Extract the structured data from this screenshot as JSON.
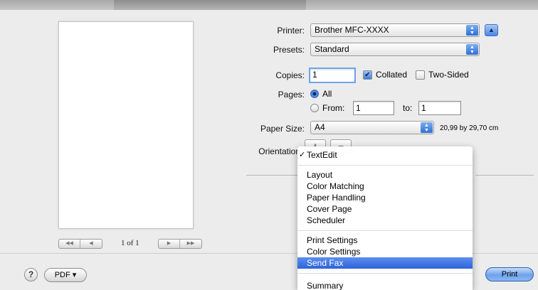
{
  "preview": {
    "page_count": "1 of 1",
    "nav_first_prev": [
      "◀◀",
      "◀"
    ],
    "nav_next_last": [
      "▶",
      "▶▶"
    ]
  },
  "printer": {
    "label": "Printer:",
    "value": "Brother MFC-XXXX",
    "disclosure": "▲"
  },
  "presets": {
    "label": "Presets:",
    "value": "Standard"
  },
  "copies": {
    "label": "Copies:",
    "value": "1",
    "collated_label": "Collated",
    "collated_checked": true,
    "two_sided_label": "Two-Sided",
    "two_sided_checked": false
  },
  "pages": {
    "label": "Pages:",
    "all_label": "All",
    "from_label": "From:",
    "from_value": "1",
    "to_label": "to:",
    "to_value": "1",
    "selected": "All"
  },
  "paper_size": {
    "label": "Paper Size:",
    "value": "A4",
    "dimensions": "20,99 by 29,70 cm"
  },
  "orientation": {
    "label": "Orientation"
  },
  "menu": {
    "checked_item": "TextEdit",
    "highlighted_item": "Send Fax",
    "groups": [
      [
        "TextEdit"
      ],
      [
        "Layout",
        "Color Matching",
        "Paper Handling",
        "Cover Page",
        "Scheduler"
      ],
      [
        "Print Settings",
        "Color Settings",
        "Send Fax"
      ],
      [
        "Summary"
      ]
    ]
  },
  "bottom": {
    "help": "?",
    "pdf_label": "PDF ▾",
    "print_label": "Print"
  },
  "colors": {
    "accent": "#2c63d9",
    "default_button": "#6ea2ec"
  }
}
